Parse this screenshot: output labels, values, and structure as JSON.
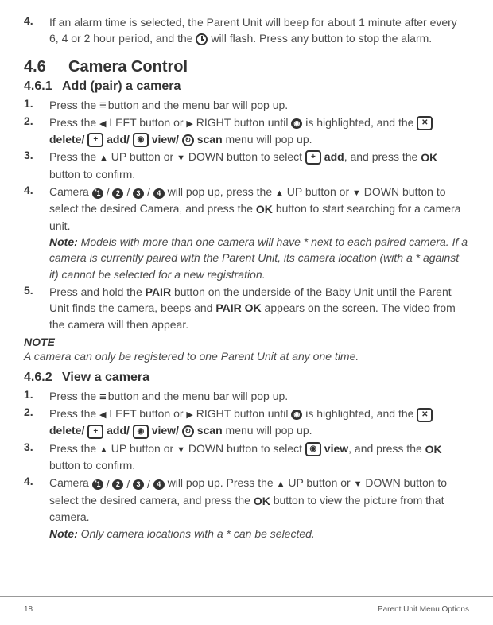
{
  "step4_prev": {
    "num": "4.",
    "t1": "If an alarm time is selected, the Parent Unit will beep for about 1 minute after every 6, 4 or 2 hour period, and the ",
    "t2": " will flash. Press any button to stop the alarm."
  },
  "sec46": {
    "num": "4.6",
    "title": "Camera Control"
  },
  "sec461": {
    "num": "4.6.1",
    "title": "Add (pair) a camera"
  },
  "pair": {
    "s1": {
      "num": "1.",
      "a": "Press the ",
      "b": " button and the menu bar will pop up."
    },
    "s2": {
      "num": "2.",
      "a": "Press the ",
      "left": " LEFT button or ",
      "right": " RIGHT button until ",
      "b": " is highlighted, and the  ",
      "del": " delete/ ",
      "add": "  add/  ",
      "view": "  view/ ",
      "scan": " scan",
      "c": " menu will pop up."
    },
    "s3": {
      "num": "3.",
      "a": "Press the ",
      "up": " UP button or ",
      "down": " DOWN button to select  ",
      "addlbl": "  add",
      "b": ", and press the ",
      "c": " button to confirm."
    },
    "s4": {
      "num": "4.",
      "a": "Camera  ",
      "b": "  will pop up, press the ",
      "up": " UP button or ",
      "down": " DOWN button to select the desired Camera, and press the ",
      "c": " button to start searching for a camera unit.",
      "noteLabel": "Note:",
      "noteText": " Models with more than one camera will have * next to each paired camera. If a camera is currently paired with the Parent Unit, its camera location (with a * against it) cannot be selected for a new registration."
    },
    "s5": {
      "num": "5.",
      "a": "Press and hold the ",
      "pair": "PAIR",
      "b": " button on the underside of the Baby Unit until the Parent Unit finds the camera, beeps and ",
      "ok": "PAIR OK",
      "c": " appears on the screen. The video from the camera will then appear."
    }
  },
  "note": {
    "head": "NOTE",
    "text": " A camera can only be registered to one Parent Unit at any one time."
  },
  "sec462": {
    "num": "4.6.2",
    "title": "View a camera"
  },
  "view": {
    "s1": {
      "num": "1.",
      "a": "Press the ",
      "b": " button and the menu bar will pop up."
    },
    "s2": {
      "num": "2.",
      "a": "Press the ",
      "left": " LEFT button or ",
      "right": " RIGHT button until ",
      "b": " is highlighted, and the  ",
      "del": " delete/ ",
      "add": "  add/  ",
      "view": "  view/ ",
      "scan": " scan",
      "c": " menu will pop up."
    },
    "s3": {
      "num": "3.",
      "a": "Press the ",
      "up": " UP button or ",
      "down": " DOWN button to select  ",
      "viewlbl": "  view",
      "b": ", and press the ",
      "c": " button to confirm."
    },
    "s4": {
      "num": "4.",
      "a": "Camera  ",
      "b": "  will pop up. Press the ",
      "up": " UP button or ",
      "down": " DOWN button to select the desired camera, and press the ",
      "c": " button to view the picture from that camera.",
      "noteLabel": "Note:",
      "noteText": " Only camera locations with a * can be selected."
    }
  },
  "footer": {
    "page": "18",
    "section": "Parent Unit Menu Options"
  },
  "icons": {
    "delete_x": "✕",
    "add_plus": "+",
    "view_dot": "◉",
    "scan_arrow": "↻",
    "cam1": "1",
    "cam2": "2",
    "cam3": "3",
    "cam4": "4",
    "star": "*",
    "ok": "OK",
    "menu": "≡",
    "left": "◀",
    "right": "▶",
    "up": "▲",
    "down": "▼"
  }
}
